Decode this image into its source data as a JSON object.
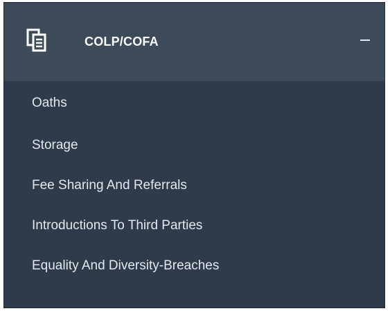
{
  "header": {
    "title": "COLP/COFA",
    "icon": "documents-icon",
    "collapse_symbol": "minus-icon"
  },
  "menu": {
    "items": [
      {
        "label": "Oaths"
      },
      {
        "label": "Storage"
      },
      {
        "label": "Fee Sharing And Referrals"
      },
      {
        "label": "Introductions To Third Parties"
      },
      {
        "label": "Equality And Diversity-Breaches"
      }
    ]
  },
  "colors": {
    "header_bg": "#3d4a5a",
    "list_bg": "#2f3b4b",
    "text": "#e4e8ee"
  }
}
